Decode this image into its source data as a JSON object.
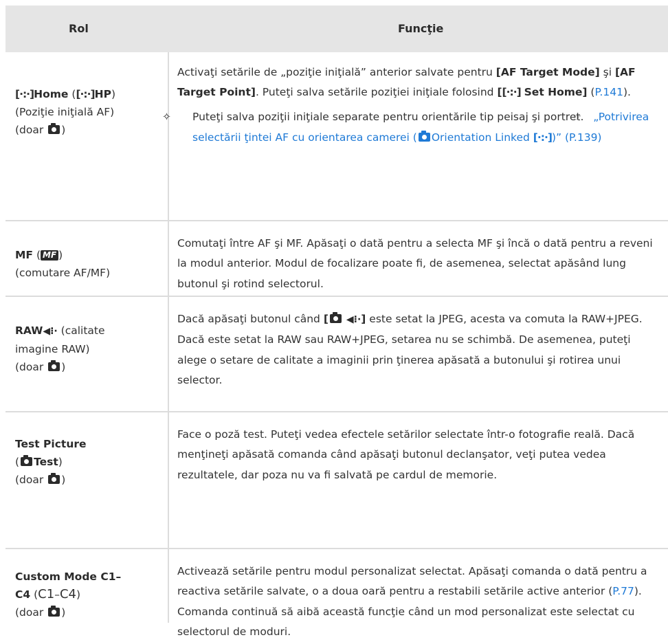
{
  "header": {
    "col1": "Rol",
    "col2": "Funcţie"
  },
  "rows": [
    {
      "role_home": "Home",
      "role_hp": "HP",
      "role_sub": "(Poziţie iniţială AF)",
      "role_doar": "(doar",
      "func_t1": "Activaţi setările de „poziţie iniţială” anterior salvate pentru ",
      "func_b1": "[AF Target Mode]",
      "func_t2": " şi ",
      "func_b2": "[AF Target Point]",
      "func_t3": ". Puteţi salva setările poziţiei iniţiale folosind ",
      "func_b3": "Set Home]",
      "func_link1": "P.141",
      "hint": "Puteţi salva poziţii iniţiale separate pentru orientările tip peisaj şi portret.",
      "hint_link": "„Potrivirea selectării ţintei AF cu orientarea camerei (",
      "hint_link2": "Orientation Linked ",
      "hint_link3": ")” (P.139)",
      "target_symbol": "[·:·]",
      "hint_icon": "bulb-hint-icon",
      "ref_icon": "hand-pointer-icon"
    },
    {
      "role_mf": "MF",
      "role_mf_icon": "MF",
      "role_sub": "(comutare AF/MF)",
      "func": "Comutaţi între AF şi MF. Apăsaţi o dată pentru a selecta MF şi încă o dată pentru a reveni la modul anterior. Modul de focalizare poate fi, de asemenea, selectat apăsând lung butonul şi rotind selectorul."
    },
    {
      "role_raw": "RAW",
      "role_sub1": " (calitate",
      "role_sub2": "imagine RAW)",
      "role_doar": "(doar",
      "func_t1": "Dacă apăsaţi butonul când ",
      "func_t2": " este setat la JPEG, acesta va comuta la RAW+JPEG. Dacă este setat la RAW sau RAW+JPEG, setarea nu se schimbă. De asemenea, puteţi alege o setare de calitate a imaginii prin ţinerea apăsată a butonului şi rotirea unui selector.",
      "raw_symbol": "◀⁝·",
      "icon_camera": "camera-icon"
    },
    {
      "role_t1": "Test Picture",
      "role_test": "Test",
      "role_doar": "(doar",
      "func": "Face o poză test. Puteţi vedea efectele setărilor selectate într-o fotografie reală. Dacă menţineţi apăsată comanda când apăsaţi butonul declanşator, veţi putea vedea rezultatele, dar poza nu va fi salvată pe cardul de memorie."
    },
    {
      "role_t1": "Custom Mode C1–",
      "role_t2": "C4",
      "role_c": "C1",
      "role_dash": "–",
      "role_c2": "C4",
      "role_doar": "(doar",
      "func_t1": "Activează setările pentru modul personalizat selectat. Apăsaţi comanda o dată pentru a reactiva setările salvate, o a doua oară pentru a restabili setările active anterior (",
      "func_link": "P.77",
      "func_t2": "). Comanda continuă să aibă această funcţie când un mod personalizat este selectat cu selectorul de moduri."
    }
  ],
  "colors": {
    "header_bg": "#e5e5e5",
    "link": "#1f7ad6",
    "rule": "#dcdcdc"
  }
}
